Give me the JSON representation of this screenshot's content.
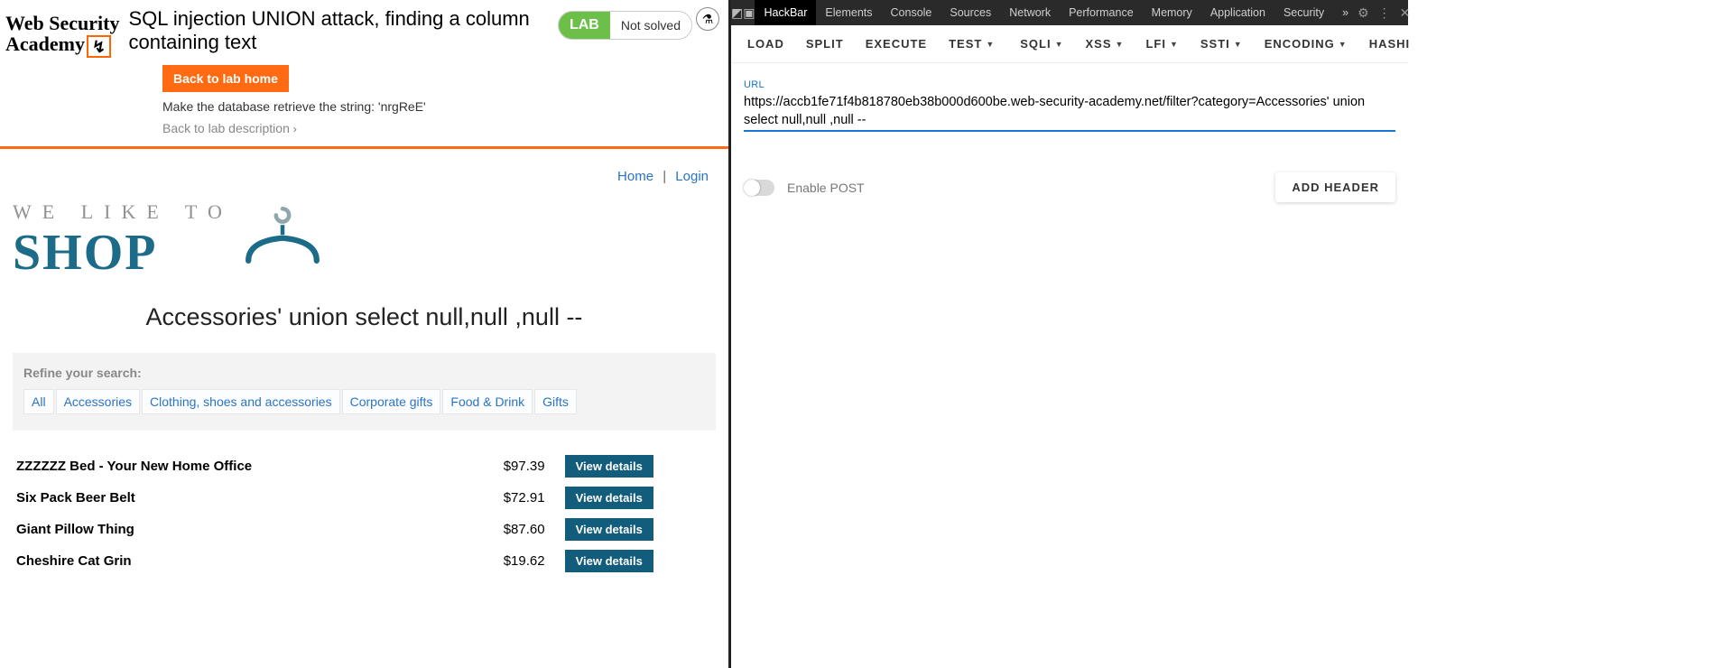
{
  "logo": {
    "line1": "Web Security",
    "line2": "Academy"
  },
  "lab": {
    "title": "SQL injection UNION attack, finding a column containing text",
    "badge_lab": "LAB",
    "badge_status": "Not solved",
    "back_home": "Back to lab home",
    "task": "Make the database retrieve the string: 'nrgReE'",
    "back_desc": "Back to lab description"
  },
  "topnav": {
    "home": "Home",
    "login": "Login"
  },
  "shop": {
    "tag": "WE LIKE TO",
    "word": "SHOP"
  },
  "heading": "Accessories' union select null,null ,null --",
  "refine": {
    "title": "Refine your search:",
    "filters": [
      "All",
      "Accessories",
      "Clothing, shoes and accessories",
      "Corporate gifts",
      "Food & Drink",
      "Gifts"
    ]
  },
  "products": [
    {
      "name": "ZZZZZZ Bed - Your New Home Office",
      "price": "$97.39"
    },
    {
      "name": "Six Pack Beer Belt",
      "price": "$72.91"
    },
    {
      "name": "Giant Pillow Thing",
      "price": "$87.60"
    },
    {
      "name": "Cheshire Cat Grin",
      "price": "$19.62"
    }
  ],
  "view_details": "View details",
  "devtools": {
    "tabs": [
      "HackBar",
      "Elements",
      "Console",
      "Sources",
      "Network",
      "Performance",
      "Memory",
      "Application",
      "Security"
    ],
    "more": "»",
    "active_tab": "HackBar"
  },
  "hackbar": {
    "buttons": [
      {
        "label": "LOAD",
        "caret": false
      },
      {
        "label": "SPLIT",
        "caret": false
      },
      {
        "label": "EXECUTE",
        "caret": false
      },
      {
        "label": "TEST",
        "caret": true,
        "divider_after": true
      },
      {
        "label": "SQLI",
        "caret": true
      },
      {
        "label": "XSS",
        "caret": true
      },
      {
        "label": "LFI",
        "caret": true
      },
      {
        "label": "SSTI",
        "caret": true
      },
      {
        "label": "ENCODING",
        "caret": true
      },
      {
        "label": "HASHI",
        "caret": false
      }
    ],
    "url_label": "URL",
    "url_value": "https://accb1fe71f4b818780eb38b000d600be.web-security-academy.net/filter?category=Accessories' union select null,null ,null --",
    "enable_post": "Enable POST",
    "add_header": "ADD HEADER"
  }
}
